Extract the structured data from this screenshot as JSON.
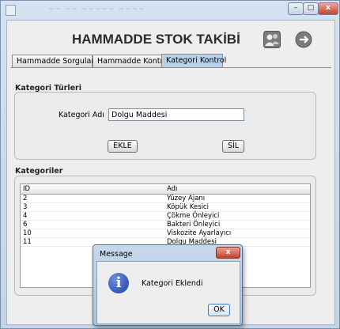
{
  "window": {
    "blurred_title": "~~ ~~ ~~~~~ ~~~~",
    "minimize": "–",
    "maximize": "□",
    "close": "x"
  },
  "app": {
    "title": "HAMMADDE STOK TAKİBİ",
    "icons": [
      "users-icon",
      "logout-icon"
    ]
  },
  "tabs": [
    {
      "label": "Hammadde Sorgulama",
      "active": false
    },
    {
      "label": "Hammadde Kontrol",
      "active": false
    },
    {
      "label": "Kategori Kontrol",
      "active": true
    }
  ],
  "kategori_turleri": {
    "section_title": "Kategori Türleri",
    "field_label": "Kategori Adı",
    "field_value": "Dolgu Maddesi",
    "add_button": "EKLE",
    "delete_button": "SİL"
  },
  "kategoriler": {
    "section_title": "Kategoriler",
    "columns": [
      "ID",
      "Adı"
    ],
    "rows": [
      [
        "2",
        "Yüzey Ajanı"
      ],
      [
        "3",
        "Köpük Kesici"
      ],
      [
        "4",
        "Çökme Önleyici"
      ],
      [
        "6",
        "Bakteri Önleyici"
      ],
      [
        "10",
        "Viskozite Ayarlayıcı"
      ],
      [
        "11",
        "Dolgu Maddesi"
      ]
    ]
  },
  "dialog": {
    "title": "Message",
    "close": "x",
    "message": "Kategori Eklendi",
    "ok_button": "OK",
    "icon": "info-icon"
  },
  "colors": {
    "active_tab": "#b6d1ea",
    "window_frame": "#c3d4e6",
    "close_red": "#c9442d"
  }
}
